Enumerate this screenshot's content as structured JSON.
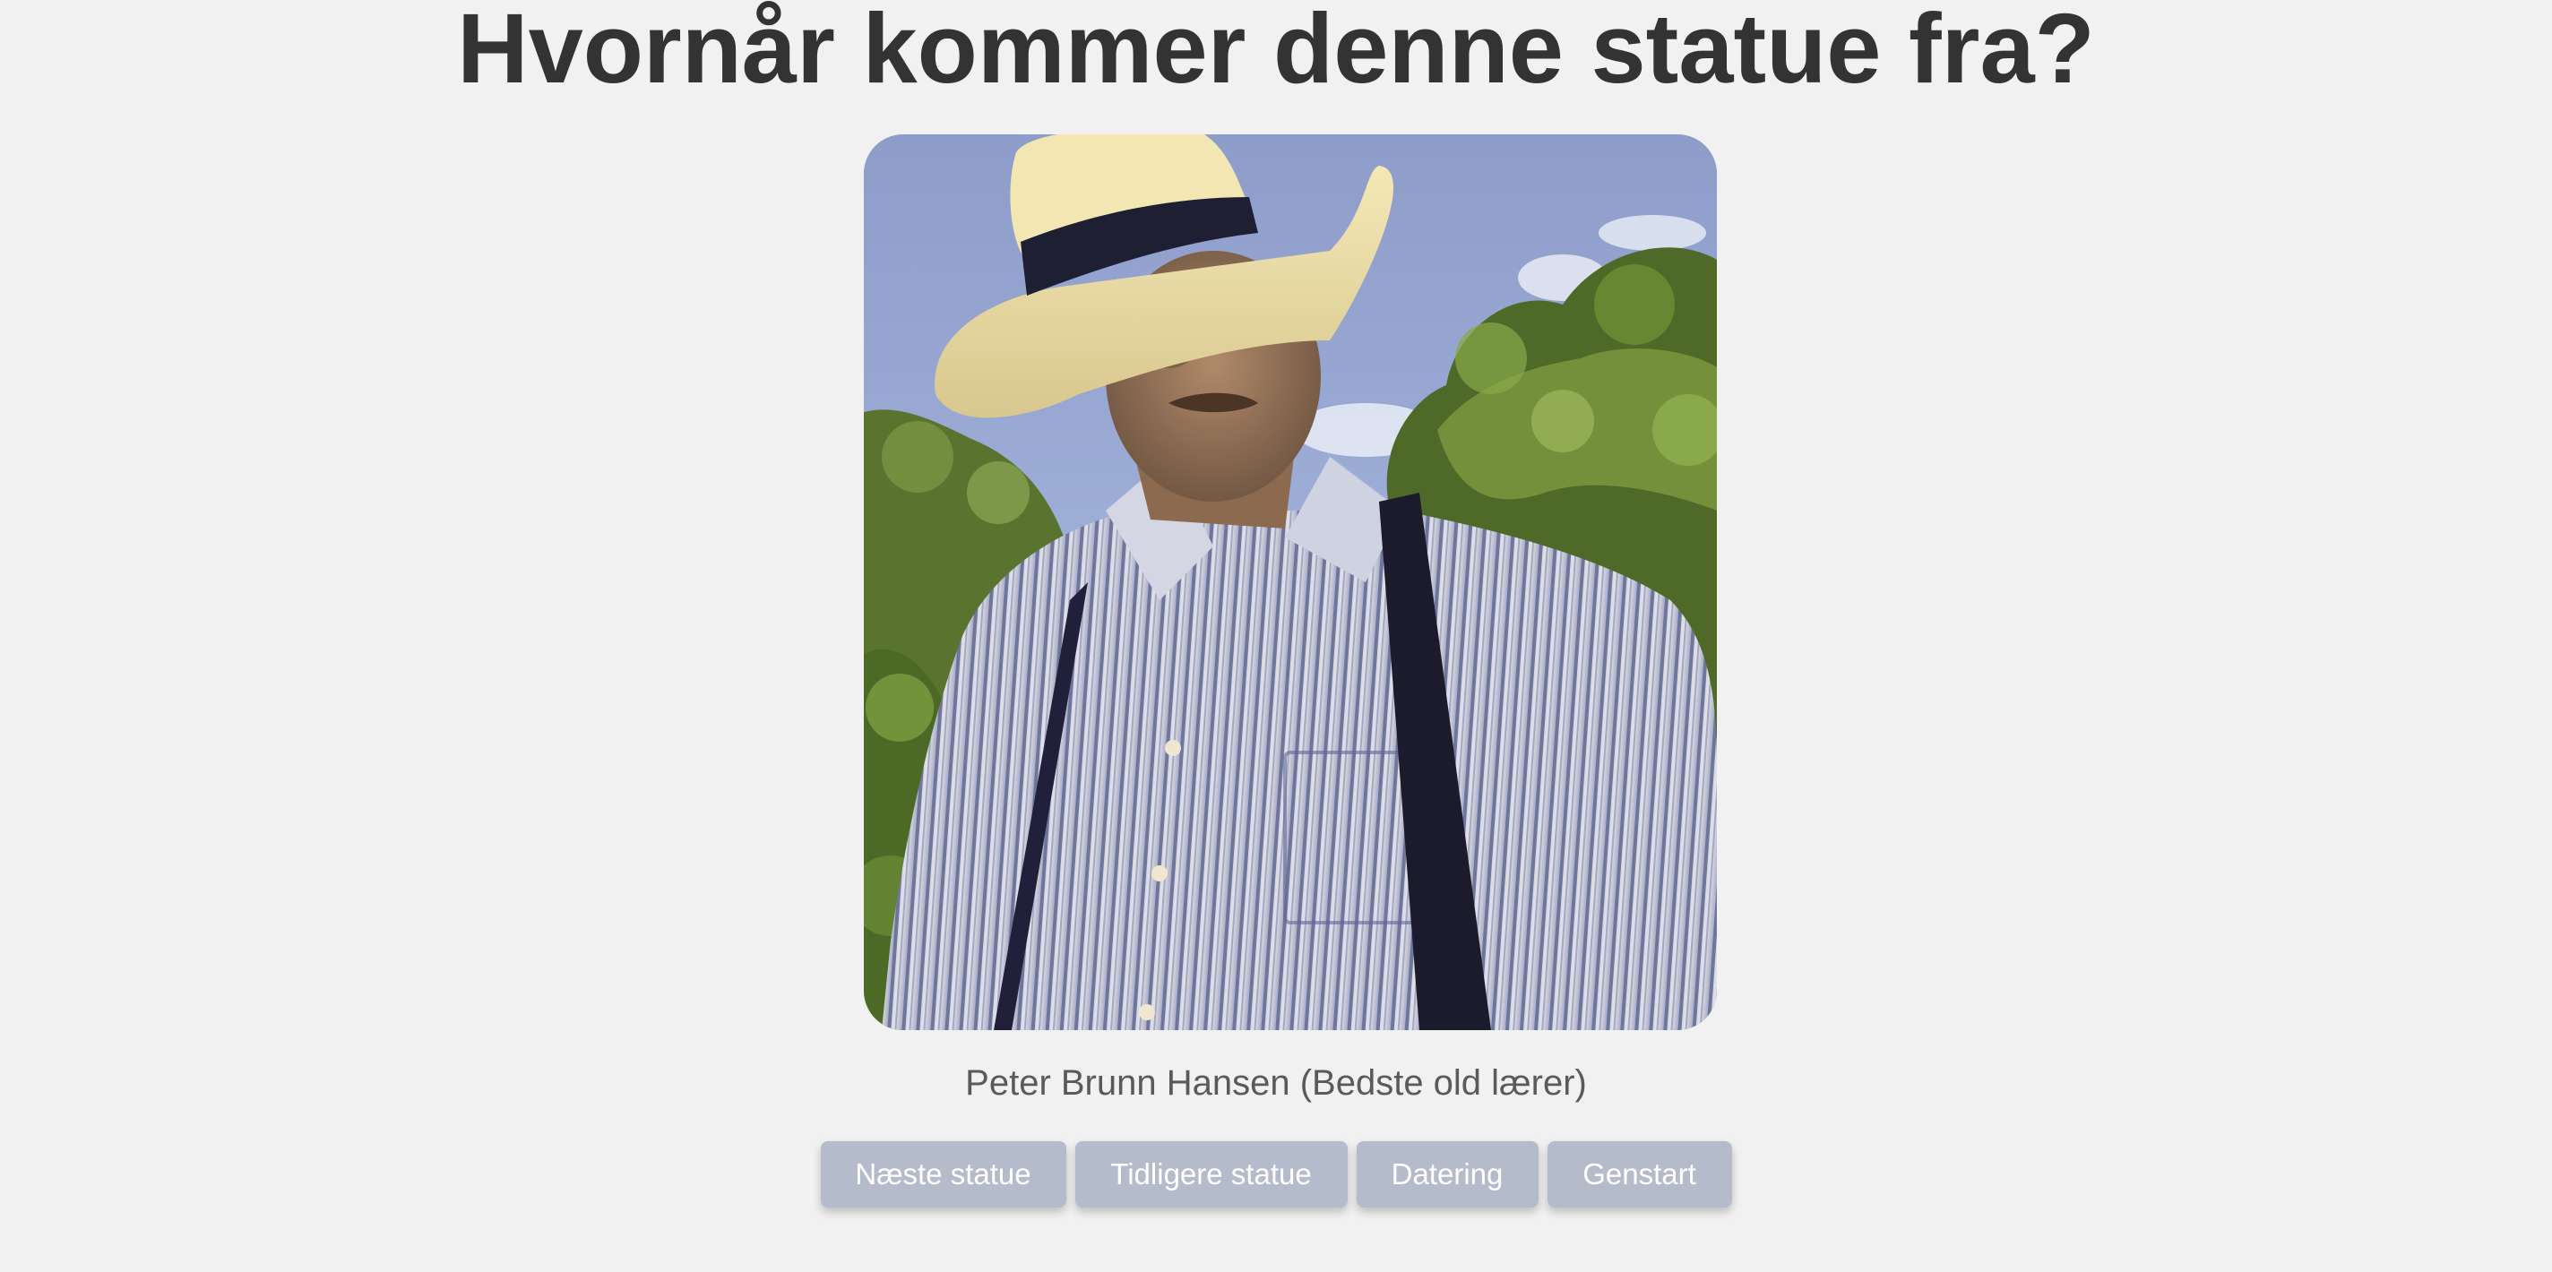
{
  "page": {
    "title": "Hvornår kommer denne statue fra?",
    "background": "#f1f1f1",
    "title_color": "#333333"
  },
  "statue": {
    "image_alt": "Portrait of a man in a straw panama hat, striped shirt and suspenders, trees and sky behind",
    "caption": "Peter Brunn Hansen (Bedste old lærer)"
  },
  "buttons": {
    "next_label": "Næste statue",
    "previous_label": "Tidligere statue",
    "dating_label": "Datering",
    "restart_label": "Genstart",
    "color": "#b4bccb",
    "text_color": "#ffffff"
  }
}
